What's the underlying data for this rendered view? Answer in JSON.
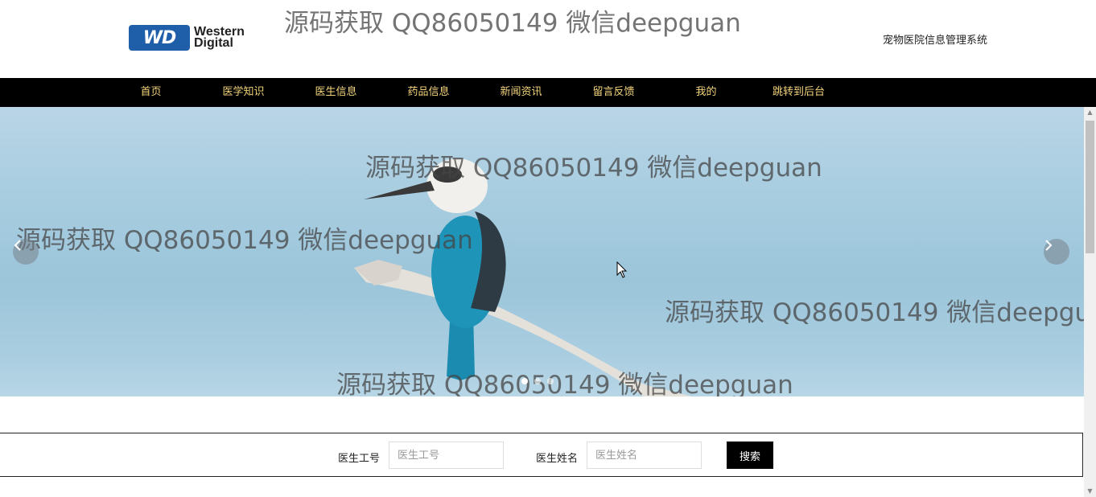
{
  "header": {
    "logo_line1": "Western",
    "logo_line2": "Digital",
    "logo_badge": "WD",
    "site_title": "宠物医院信息管理系统"
  },
  "nav": {
    "items": [
      "首页",
      "医学知识",
      "医生信息",
      "药品信息",
      "新闻资讯",
      "留言反馈",
      "我的",
      "跳转到后台"
    ]
  },
  "watermark": "源码获取 QQ86050149 微信deepguan",
  "banner": {
    "prev_icon": "chevron-left",
    "next_icon": "chevron-right",
    "slide_count": 3,
    "active_slide": 1
  },
  "search": {
    "doctor_id_label": "医生工号",
    "doctor_id_placeholder": "医生工号",
    "doctor_name_label": "医生姓名",
    "doctor_name_placeholder": "医生姓名",
    "search_button": "搜索"
  },
  "colors": {
    "nav_bg": "#000000",
    "nav_text": "#f3d37a",
    "button_bg": "#000000",
    "logo_blue": "#1f5ea8"
  }
}
